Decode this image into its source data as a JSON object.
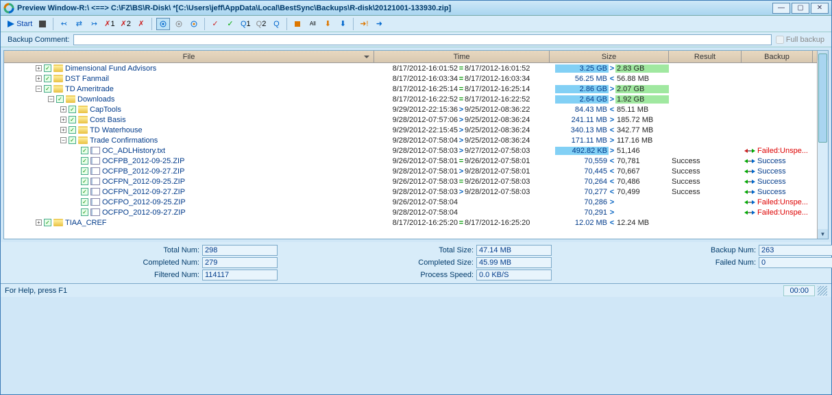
{
  "window": {
    "title": "Preview Window-R:\\ <==> C:\\FZ\\BS\\R-Disk\\ *[C:\\Users\\jeff\\AppData\\Local\\BestSync\\Backups\\R-disk\\20121001-133930.zip]"
  },
  "toolbar": {
    "start_label": "Start"
  },
  "commentbar": {
    "label": "Backup Comment:",
    "full_backup": "Full backup"
  },
  "columns": {
    "file": "File",
    "time": "Time",
    "size": "Size",
    "result": "Result",
    "backup": "Backup"
  },
  "colw": {
    "file": 540,
    "time": 256,
    "size": 174,
    "result": 106,
    "backup": 106
  },
  "rows": [
    {
      "depth": 0,
      "exp": "+",
      "folder": true,
      "name": "Dimensional Fund Advisors",
      "t1": "8/17/2012-16:01:52",
      "tc": "=",
      "t2": "8/17/2012-16:01:52",
      "s1": "3.25 GB",
      "sc": ">",
      "s2": "2.83 GB",
      "s1hl": true,
      "s2hl": true
    },
    {
      "depth": 0,
      "exp": "+",
      "folder": true,
      "name": "DST Fanmail",
      "t1": "8/17/2012-16:03:34",
      "tc": "=",
      "t2": "8/17/2012-16:03:34",
      "s1": "56.25 MB",
      "sc": "<",
      "s2": "56.88 MB"
    },
    {
      "depth": 0,
      "exp": "-",
      "folder": true,
      "name": "TD Ameritrade",
      "t1": "8/17/2012-16:25:14",
      "tc": "=",
      "t2": "8/17/2012-16:25:14",
      "s1": "2.86 GB",
      "sc": ">",
      "s2": "2.07 GB",
      "s1hl": true,
      "s2hl": true
    },
    {
      "depth": 1,
      "exp": "-",
      "folder": true,
      "name": "Downloads",
      "t1": "8/17/2012-16:22:52",
      "tc": "=",
      "t2": "8/17/2012-16:22:52",
      "s1": "2.64 GB",
      "sc": ">",
      "s2": "1.92 GB",
      "s1hl": true,
      "s2hl": true
    },
    {
      "depth": 2,
      "exp": "+",
      "folder": true,
      "name": "CapTools",
      "t1": "9/29/2012-22:15:36",
      "tc": ">",
      "t2": "9/25/2012-08:36:22",
      "s1": "84.43 MB",
      "sc": "<",
      "s2": "85.11 MB"
    },
    {
      "depth": 2,
      "exp": "+",
      "folder": true,
      "name": "Cost Basis",
      "t1": "9/28/2012-07:57:06",
      "tc": ">",
      "t2": "9/25/2012-08:36:24",
      "s1": "241.11 MB",
      "sc": ">",
      "s2": "185.72 MB"
    },
    {
      "depth": 2,
      "exp": "+",
      "folder": true,
      "name": "TD Waterhouse",
      "t1": "9/29/2012-22:15:45",
      "tc": ">",
      "t2": "9/25/2012-08:36:24",
      "s1": "340.13 MB",
      "sc": "<",
      "s2": "342.77 MB"
    },
    {
      "depth": 2,
      "exp": "-",
      "folder": true,
      "name": "Trade Confirmations",
      "t1": "9/28/2012-07:58:04",
      "tc": ">",
      "t2": "9/25/2012-08:36:24",
      "s1": "171.11 MB",
      "sc": ">",
      "s2": "117.16 MB"
    },
    {
      "depth": 3,
      "folder": false,
      "name": "OC_ADLHistory.txt",
      "t1": "9/28/2012-07:58:03",
      "tc": ">",
      "t2": "9/27/2012-07:58:03",
      "s1": "492.82 KB",
      "sc": ">",
      "s2": "51,146",
      "s1hl": true,
      "backup": "Failed:Unspe...",
      "bok": false,
      "bico": "rg"
    },
    {
      "depth": 3,
      "folder": false,
      "name": "OCFPB_2012-09-25.ZIP",
      "t1": "9/26/2012-07:58:01",
      "tc": "=",
      "t2": "9/26/2012-07:58:01",
      "s1": "70,559",
      "sc": "<",
      "s2": "70,781",
      "result": "Success",
      "backup": "Success",
      "bok": true,
      "bico": "gb"
    },
    {
      "depth": 3,
      "folder": false,
      "name": "OCFPB_2012-09-27.ZIP",
      "t1": "9/28/2012-07:58:01",
      "tc": ">",
      "t2": "9/28/2012-07:58:01",
      "s1": "70,445",
      "sc": "<",
      "s2": "70,667",
      "result": "Success",
      "backup": "Success",
      "bok": true,
      "bico": "gb"
    },
    {
      "depth": 3,
      "folder": false,
      "name": "OCFPN_2012-09-25.ZIP",
      "t1": "9/26/2012-07:58:03",
      "tc": "=",
      "t2": "9/26/2012-07:58:03",
      "s1": "70,264",
      "sc": "<",
      "s2": "70,486",
      "result": "Success",
      "backup": "Success",
      "bok": true,
      "bico": "gb"
    },
    {
      "depth": 3,
      "folder": false,
      "name": "OCFPN_2012-09-27.ZIP",
      "t1": "9/28/2012-07:58:03",
      "tc": ">",
      "t2": "9/28/2012-07:58:03",
      "s1": "70,277",
      "sc": "<",
      "s2": "70,499",
      "result": "Success",
      "backup": "Success",
      "bok": true,
      "bico": "gb"
    },
    {
      "depth": 3,
      "folder": false,
      "name": "OCFPO_2012-09-25.ZIP",
      "t1": "9/26/2012-07:58:04",
      "tc": "",
      "t2": "",
      "s1": "70,286",
      "sc": ">",
      "s2": "",
      "backup": "Failed:Unspe...",
      "bok": false,
      "bico": "gb"
    },
    {
      "depth": 3,
      "folder": false,
      "name": "OCFPO_2012-09-27.ZIP",
      "t1": "9/28/2012-07:58:04",
      "tc": "",
      "t2": "",
      "s1": "70,291",
      "sc": ">",
      "s2": "",
      "backup": "Failed:Unspe...",
      "bok": false,
      "bico": "gb"
    },
    {
      "depth": 0,
      "exp": "+",
      "folder": true,
      "name": "TIAA_CREF",
      "t1": "8/17/2012-16:25:20",
      "tc": "=",
      "t2": "8/17/2012-16:25:20",
      "s1": "12.02 MB",
      "sc": "<",
      "s2": "12.24 MB"
    }
  ],
  "stats": {
    "total_num_lbl": "Total Num:",
    "total_num": "298",
    "completed_num_lbl": "Completed Num:",
    "completed_num": "279",
    "filtered_num_lbl": "Filtered Num:",
    "filtered_num": "114117",
    "total_size_lbl": "Total Size:",
    "total_size": "47.14 MB",
    "completed_size_lbl": "Completed Size:",
    "completed_size": "45.99 MB",
    "process_speed_lbl": "Process Speed:",
    "process_speed": "0.0 KB/S",
    "backup_num_lbl": "Backup Num:",
    "backup_num": "263",
    "failed_num_lbl": "Failed Num:",
    "failed_num": "0"
  },
  "status": {
    "help": "For Help, press F1",
    "time": "00:00"
  }
}
